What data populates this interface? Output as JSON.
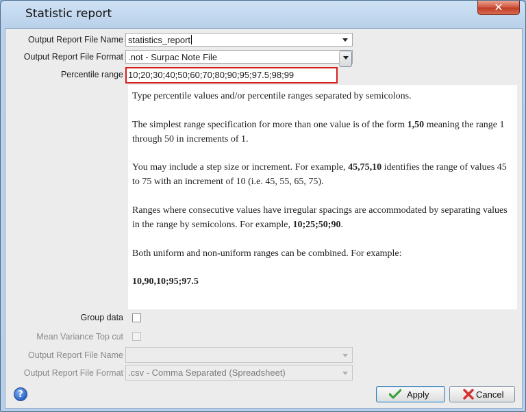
{
  "window": {
    "title": "Statistic report",
    "close_symbol": "✕"
  },
  "form": {
    "output_file_name": {
      "label": "Output Report File Name",
      "value": "statistics_report"
    },
    "output_file_format": {
      "label": "Output Report File Format",
      "value": ".not - Surpac Note File"
    },
    "percentile_range": {
      "label": "Percentile range",
      "value": "10;20;30;40;50;60;70;80;90;95;97.5;98;99"
    },
    "group_data": {
      "label": "Group data",
      "checked": false
    },
    "mean_variance_top_cut": {
      "label": "Mean Variance Top cut",
      "checked": false,
      "enabled": false
    },
    "output_file_name_2": {
      "label": "Output Report File Name",
      "value": "",
      "enabled": false
    },
    "output_file_format_2": {
      "label": "Output Report File Format",
      "value": ".csv - Comma Separated (Spreadsheet)",
      "enabled": false
    }
  },
  "help": {
    "p1": "Type percentile values and/or percentile ranges separated by semicolons.",
    "p2_pre": "The simplest range specification for more than one value is of the form ",
    "p2_bold": "1,50",
    "p2_post": " meaning the range 1 through 50 in increments of 1.",
    "p3_pre": "You may include a step size or increment. For example, ",
    "p3_bold": "45,75,10",
    "p3_post": " identifies the range of values 45 to 75 with an increment of 10 (i.e. 45, 55, 65, 75).",
    "p4_pre": "Ranges where consecutive values have irregular spacings are accommodated by separating values in the range by semicolons. For example, ",
    "p4_bold": "10;25;50;90",
    "p4_post": ".",
    "p5": "Both uniform and non-uniform ranges can be combined. For example:",
    "p6_bold": "10,90,10;95;97.5"
  },
  "buttons": {
    "help": "?",
    "apply": "Apply",
    "cancel": "Cancel"
  },
  "colors": {
    "highlight_border": "#d51d1d",
    "apply_icon": "#3aa33a",
    "cancel_icon": "#d62f2f"
  },
  "icons": {
    "help": "help-icon",
    "apply": "checkmark-icon",
    "cancel": "cancel-x-icon",
    "close": "close-icon"
  }
}
